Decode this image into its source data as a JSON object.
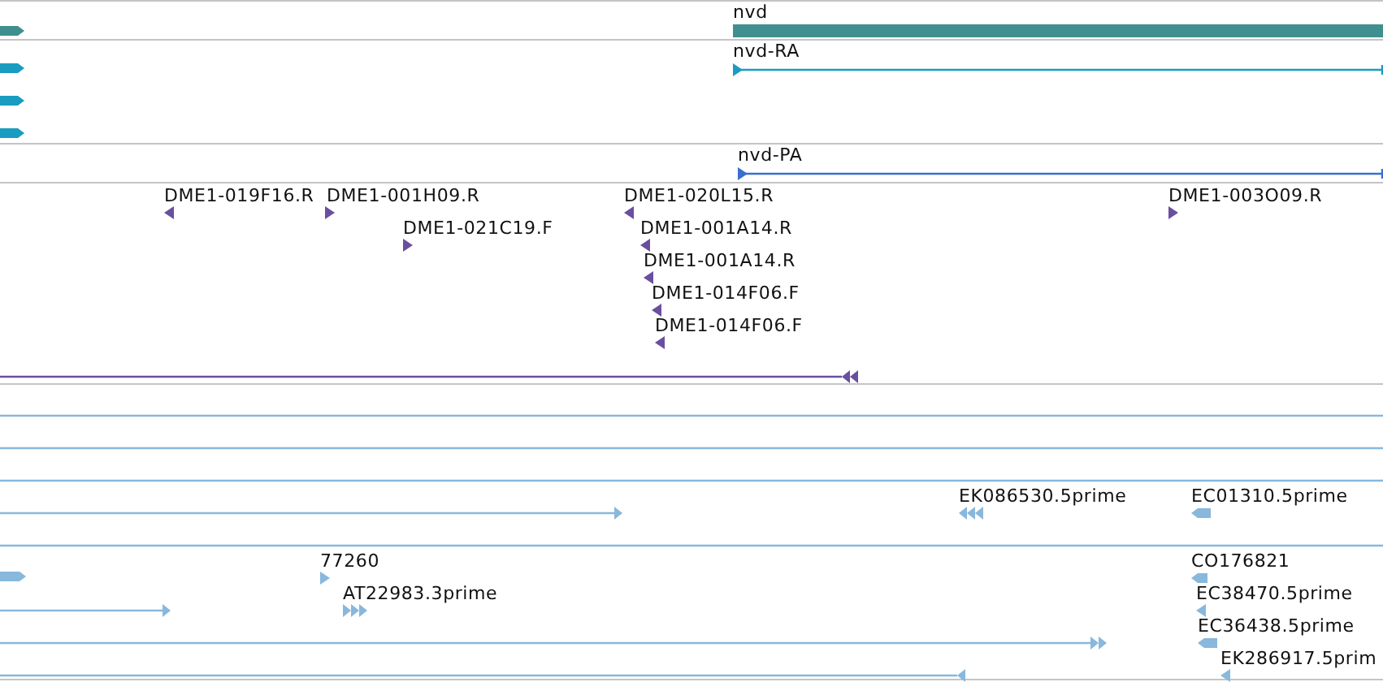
{
  "tracks": [
    {
      "kind": "gene",
      "features": [
        {
          "kind": "block",
          "reverse": false
        },
        {
          "kind": "bar",
          "label": "nvd"
        }
      ]
    },
    {
      "kind": "transcript",
      "features": [
        {
          "kind": "block",
          "reverse": false
        },
        {
          "kind": "block",
          "reverse": false
        },
        {
          "kind": "block",
          "reverse": false
        },
        {
          "kind": "start",
          "label": "nvd-RA",
          "reverse": false
        }
      ]
    },
    {
      "kind": "protein",
      "features": [
        {
          "kind": "start",
          "label": "nvd-PA",
          "reverse": false
        }
      ]
    },
    {
      "kind": "clone",
      "features": [
        {
          "kind": "tri",
          "label": "DME1-019F16.R",
          "reverse": true
        },
        {
          "kind": "tri",
          "label": "DME1-001H09.R",
          "reverse": false
        },
        {
          "kind": "tri",
          "label": "DME1-021C19.F",
          "reverse": false
        },
        {
          "kind": "tri",
          "label": "DME1-020L15.R",
          "reverse": true
        },
        {
          "kind": "tri",
          "label": "DME1-001A14.R",
          "reverse": true
        },
        {
          "kind": "tri",
          "label": "DME1-001A14.R",
          "reverse": true
        },
        {
          "kind": "tri",
          "label": "DME1-014F06.F",
          "reverse": true
        },
        {
          "kind": "tri",
          "label": "DME1-014F06.F",
          "reverse": true
        },
        {
          "kind": "tri",
          "label": "DME1-003O09.R",
          "reverse": false
        },
        {
          "kind": "line",
          "reverse": true
        }
      ]
    },
    {
      "kind": "est",
      "features": [
        {
          "kind": "line"
        },
        {
          "kind": "line"
        },
        {
          "kind": "line"
        },
        {
          "kind": "line",
          "reverse": false
        },
        {
          "kind": "line"
        },
        {
          "kind": "line",
          "reverse": false
        },
        {
          "kind": "line",
          "reverse": false
        },
        {
          "kind": "line",
          "reverse": true
        },
        {
          "kind": "multi",
          "label": "EK086530.5prime",
          "reverse": true
        },
        {
          "kind": "block",
          "label": "EC01310.5prime",
          "reverse": true
        },
        {
          "kind": "block",
          "reverse": false
        },
        {
          "kind": "tri",
          "label": "77260",
          "reverse": false
        },
        {
          "kind": "multi",
          "label": "AT22983.3prime",
          "reverse": false
        },
        {
          "kind": "block",
          "label": "CO176821",
          "reverse": true
        },
        {
          "kind": "tri",
          "label": "EC38470.5prime",
          "reverse": true
        },
        {
          "kind": "block",
          "label": "EC36438.5prime",
          "reverse": true
        },
        {
          "kind": "tri",
          "label": "EK286917.5prim",
          "reverse": true
        }
      ]
    }
  ]
}
